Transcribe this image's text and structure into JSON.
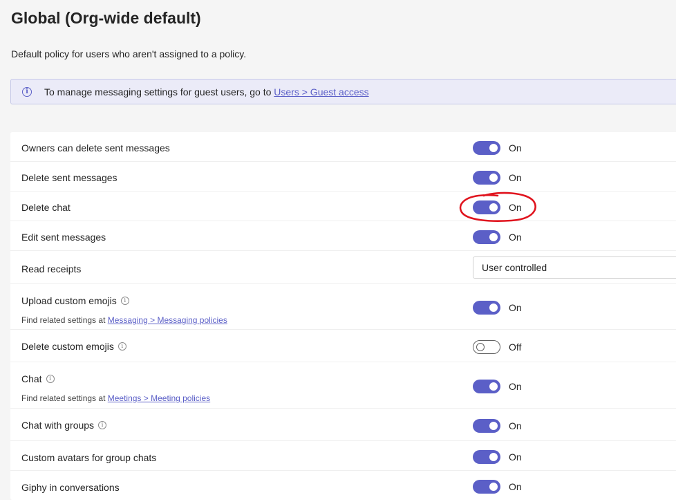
{
  "header": {
    "title": "Global (Org-wide default)",
    "subtitle": "Default policy for users who aren't assigned to a policy."
  },
  "banner": {
    "icon": "info-icon",
    "text": "To manage messaging settings for guest users, go to ",
    "link": "Users > Guest access"
  },
  "settings": [
    {
      "label": "Owners can delete sent messages",
      "state": "On"
    },
    {
      "label": "Delete sent messages",
      "state": "On"
    },
    {
      "label": "Delete chat",
      "state": "On"
    },
    {
      "label": "Edit sent messages",
      "state": "On"
    },
    {
      "label": "Read receipts",
      "value": "User controlled"
    },
    {
      "label": "Upload custom emojis",
      "state": "On",
      "related_prefix": "Find related settings at ",
      "related_link": "Messaging > Messaging policies"
    },
    {
      "label": "Delete custom emojis",
      "state": "Off"
    },
    {
      "label": "Chat",
      "state": "On",
      "related_prefix": "Find related settings at ",
      "related_link": "Meetings > Meeting policies"
    },
    {
      "label": "Chat with groups",
      "state": "On"
    },
    {
      "label": "Custom avatars for group chats",
      "state": "On"
    },
    {
      "label": "Giphy in conversations",
      "state": "On"
    }
  ],
  "colors": {
    "accent": "#5b5fc7",
    "annotation": "#e0141e"
  }
}
